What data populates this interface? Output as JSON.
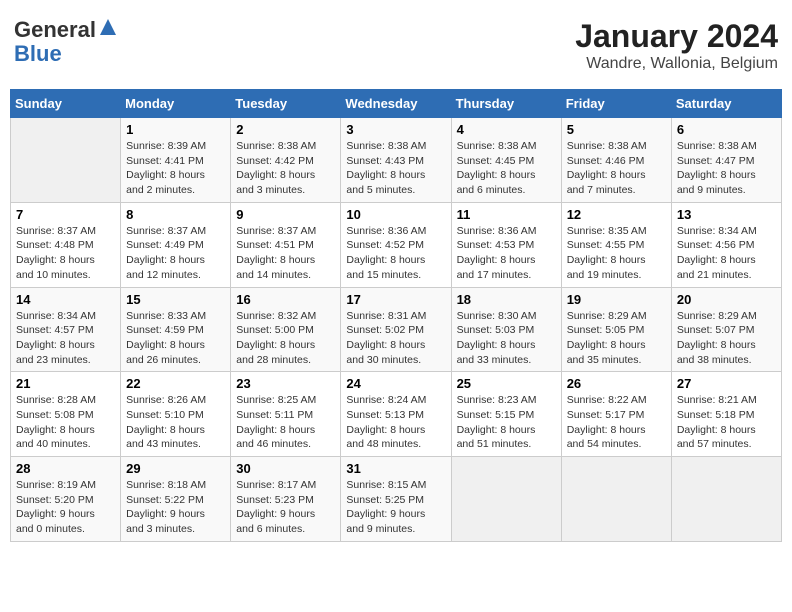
{
  "logo": {
    "general": "General",
    "blue": "Blue"
  },
  "title": "January 2024",
  "subtitle": "Wandre, Wallonia, Belgium",
  "days_of_week": [
    "Sunday",
    "Monday",
    "Tuesday",
    "Wednesday",
    "Thursday",
    "Friday",
    "Saturday"
  ],
  "weeks": [
    [
      {
        "day": "",
        "info": ""
      },
      {
        "day": "1",
        "info": "Sunrise: 8:39 AM\nSunset: 4:41 PM\nDaylight: 8 hours\nand 2 minutes."
      },
      {
        "day": "2",
        "info": "Sunrise: 8:38 AM\nSunset: 4:42 PM\nDaylight: 8 hours\nand 3 minutes."
      },
      {
        "day": "3",
        "info": "Sunrise: 8:38 AM\nSunset: 4:43 PM\nDaylight: 8 hours\nand 5 minutes."
      },
      {
        "day": "4",
        "info": "Sunrise: 8:38 AM\nSunset: 4:45 PM\nDaylight: 8 hours\nand 6 minutes."
      },
      {
        "day": "5",
        "info": "Sunrise: 8:38 AM\nSunset: 4:46 PM\nDaylight: 8 hours\nand 7 minutes."
      },
      {
        "day": "6",
        "info": "Sunrise: 8:38 AM\nSunset: 4:47 PM\nDaylight: 8 hours\nand 9 minutes."
      }
    ],
    [
      {
        "day": "7",
        "info": "Sunrise: 8:37 AM\nSunset: 4:48 PM\nDaylight: 8 hours\nand 10 minutes."
      },
      {
        "day": "8",
        "info": "Sunrise: 8:37 AM\nSunset: 4:49 PM\nDaylight: 8 hours\nand 12 minutes."
      },
      {
        "day": "9",
        "info": "Sunrise: 8:37 AM\nSunset: 4:51 PM\nDaylight: 8 hours\nand 14 minutes."
      },
      {
        "day": "10",
        "info": "Sunrise: 8:36 AM\nSunset: 4:52 PM\nDaylight: 8 hours\nand 15 minutes."
      },
      {
        "day": "11",
        "info": "Sunrise: 8:36 AM\nSunset: 4:53 PM\nDaylight: 8 hours\nand 17 minutes."
      },
      {
        "day": "12",
        "info": "Sunrise: 8:35 AM\nSunset: 4:55 PM\nDaylight: 8 hours\nand 19 minutes."
      },
      {
        "day": "13",
        "info": "Sunrise: 8:34 AM\nSunset: 4:56 PM\nDaylight: 8 hours\nand 21 minutes."
      }
    ],
    [
      {
        "day": "14",
        "info": "Sunrise: 8:34 AM\nSunset: 4:57 PM\nDaylight: 8 hours\nand 23 minutes."
      },
      {
        "day": "15",
        "info": "Sunrise: 8:33 AM\nSunset: 4:59 PM\nDaylight: 8 hours\nand 26 minutes."
      },
      {
        "day": "16",
        "info": "Sunrise: 8:32 AM\nSunset: 5:00 PM\nDaylight: 8 hours\nand 28 minutes."
      },
      {
        "day": "17",
        "info": "Sunrise: 8:31 AM\nSunset: 5:02 PM\nDaylight: 8 hours\nand 30 minutes."
      },
      {
        "day": "18",
        "info": "Sunrise: 8:30 AM\nSunset: 5:03 PM\nDaylight: 8 hours\nand 33 minutes."
      },
      {
        "day": "19",
        "info": "Sunrise: 8:29 AM\nSunset: 5:05 PM\nDaylight: 8 hours\nand 35 minutes."
      },
      {
        "day": "20",
        "info": "Sunrise: 8:29 AM\nSunset: 5:07 PM\nDaylight: 8 hours\nand 38 minutes."
      }
    ],
    [
      {
        "day": "21",
        "info": "Sunrise: 8:28 AM\nSunset: 5:08 PM\nDaylight: 8 hours\nand 40 minutes."
      },
      {
        "day": "22",
        "info": "Sunrise: 8:26 AM\nSunset: 5:10 PM\nDaylight: 8 hours\nand 43 minutes."
      },
      {
        "day": "23",
        "info": "Sunrise: 8:25 AM\nSunset: 5:11 PM\nDaylight: 8 hours\nand 46 minutes."
      },
      {
        "day": "24",
        "info": "Sunrise: 8:24 AM\nSunset: 5:13 PM\nDaylight: 8 hours\nand 48 minutes."
      },
      {
        "day": "25",
        "info": "Sunrise: 8:23 AM\nSunset: 5:15 PM\nDaylight: 8 hours\nand 51 minutes."
      },
      {
        "day": "26",
        "info": "Sunrise: 8:22 AM\nSunset: 5:17 PM\nDaylight: 8 hours\nand 54 minutes."
      },
      {
        "day": "27",
        "info": "Sunrise: 8:21 AM\nSunset: 5:18 PM\nDaylight: 8 hours\nand 57 minutes."
      }
    ],
    [
      {
        "day": "28",
        "info": "Sunrise: 8:19 AM\nSunset: 5:20 PM\nDaylight: 9 hours\nand 0 minutes."
      },
      {
        "day": "29",
        "info": "Sunrise: 8:18 AM\nSunset: 5:22 PM\nDaylight: 9 hours\nand 3 minutes."
      },
      {
        "day": "30",
        "info": "Sunrise: 8:17 AM\nSunset: 5:23 PM\nDaylight: 9 hours\nand 6 minutes."
      },
      {
        "day": "31",
        "info": "Sunrise: 8:15 AM\nSunset: 5:25 PM\nDaylight: 9 hours\nand 9 minutes."
      },
      {
        "day": "",
        "info": ""
      },
      {
        "day": "",
        "info": ""
      },
      {
        "day": "",
        "info": ""
      }
    ]
  ]
}
